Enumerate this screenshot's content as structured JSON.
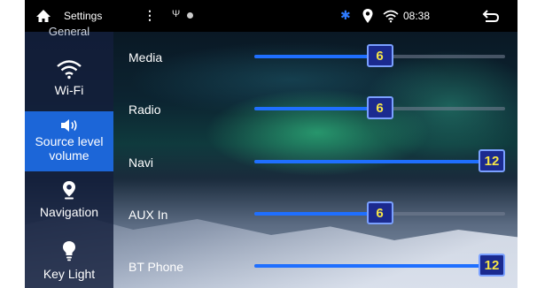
{
  "status_bar": {
    "title": "Settings",
    "time": "08:38",
    "bluetooth_color": "#2e7bff"
  },
  "sidebar": {
    "items": [
      {
        "label": "General",
        "icon": "general-icon",
        "active": false
      },
      {
        "label": "Wi-Fi",
        "icon": "wifi-icon",
        "active": false
      },
      {
        "label": "Source level volume",
        "icon": "speaker-icon",
        "active": true
      },
      {
        "label": "Navigation",
        "icon": "location-pin-icon",
        "active": false
      },
      {
        "label": "Key Light",
        "icon": "bulb-icon",
        "active": false
      }
    ]
  },
  "volume": {
    "max": 12,
    "rows": [
      {
        "label": "Media",
        "value": "6"
      },
      {
        "label": "Radio",
        "value": "6"
      },
      {
        "label": "Navi",
        "value": "12"
      },
      {
        "label": "AUX In",
        "value": "6"
      },
      {
        "label": "BT Phone",
        "value": "12"
      }
    ]
  },
  "colors": {
    "accent": "#1c66d8",
    "knob": "#1b2a8f",
    "knob_text": "#f6e547",
    "slider_fill": "#1f6fff"
  }
}
